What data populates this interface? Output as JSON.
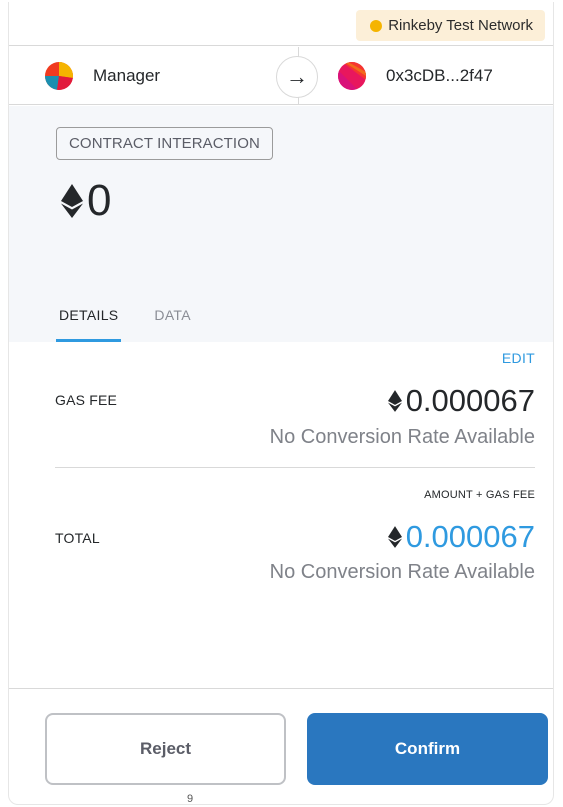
{
  "network": {
    "label": "Rinkeby Test Network",
    "dot_color": "#f5b400"
  },
  "accounts": {
    "sender_name": "Manager",
    "sender_avatar_icon": "jazzicon-avatar",
    "recipient_address": "0x3cDB...2f47",
    "recipient_avatar_icon": "jazzicon-avatar",
    "arrow_icon": "arrow-right-icon"
  },
  "summary": {
    "action_badge": "CONTRACT INTERACTION",
    "amount": "0",
    "currency_icon": "ethereum-icon"
  },
  "tabs": [
    {
      "label": "DETAILS",
      "active": true
    },
    {
      "label": "DATA",
      "active": false
    }
  ],
  "details": {
    "edit_label": "EDIT",
    "gas_fee": {
      "label": "GAS FEE",
      "amount": "0.000067",
      "conversion": "No Conversion Rate Available"
    },
    "total": {
      "label": "TOTAL",
      "hint": "AMOUNT + GAS FEE",
      "amount": "0.000067",
      "conversion": "No Conversion Rate Available",
      "amount_color": "#2f9ae0"
    }
  },
  "footer": {
    "reject_label": "Reject",
    "confirm_label": "Confirm",
    "confirm_color": "#2a77bf",
    "page_number": "9"
  }
}
